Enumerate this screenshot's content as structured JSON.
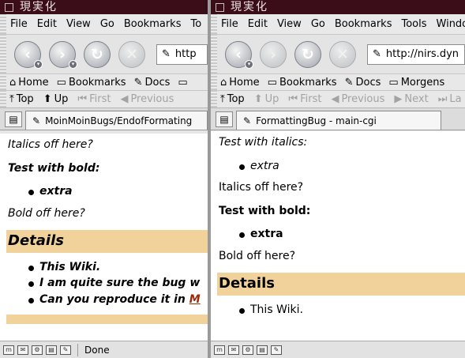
{
  "left": {
    "title": "現実化",
    "menu": [
      "File",
      "Edit",
      "View",
      "Go",
      "Bookmarks",
      "To"
    ],
    "nav": {
      "back": "back",
      "forward": "forward",
      "reload": "reload",
      "stop": "stop"
    },
    "url": "http",
    "bookmarks": [
      "Home",
      "Bookmarks",
      "Docs",
      ""
    ],
    "site": [
      "Top",
      "Up",
      "First",
      "Previous"
    ],
    "tab": "MoinMoinBugs/EndofFormating",
    "content": {
      "line1": "Italics off here?",
      "bold_heading": "Test with bold:",
      "bold_item": "extra",
      "bold_off": "Bold off here?",
      "details": "Details",
      "item1": "This Wiki.",
      "item2": "I am quite sure the bug w",
      "item3_pre": "Can you reproduce it in ",
      "item3_link": "M"
    },
    "status": "Done"
  },
  "right": {
    "title": "現実化",
    "menu": [
      "File",
      "Edit",
      "View",
      "Go",
      "Bookmarks",
      "Tools",
      "Windo"
    ],
    "url": "http://nirs.dyn",
    "bookmarks": [
      "Home",
      "Bookmarks",
      "Docs",
      "Morgens"
    ],
    "site": [
      "Top",
      "Up",
      "First",
      "Previous",
      "Next",
      "La"
    ],
    "tab": "FormattingBug - main-cgi",
    "content": {
      "line1": "Test with italics:",
      "italic_item": "extra",
      "italics_off": "Italics off here?",
      "bold_heading": "Test with bold:",
      "bold_item": "extra",
      "bold_off": "Bold off here?",
      "details": "Details",
      "item1": "This Wiki."
    }
  },
  "colors": {
    "titlebar": "#3a0d18",
    "heading_bg": "#f1d29b",
    "link": "#9c2a06"
  }
}
